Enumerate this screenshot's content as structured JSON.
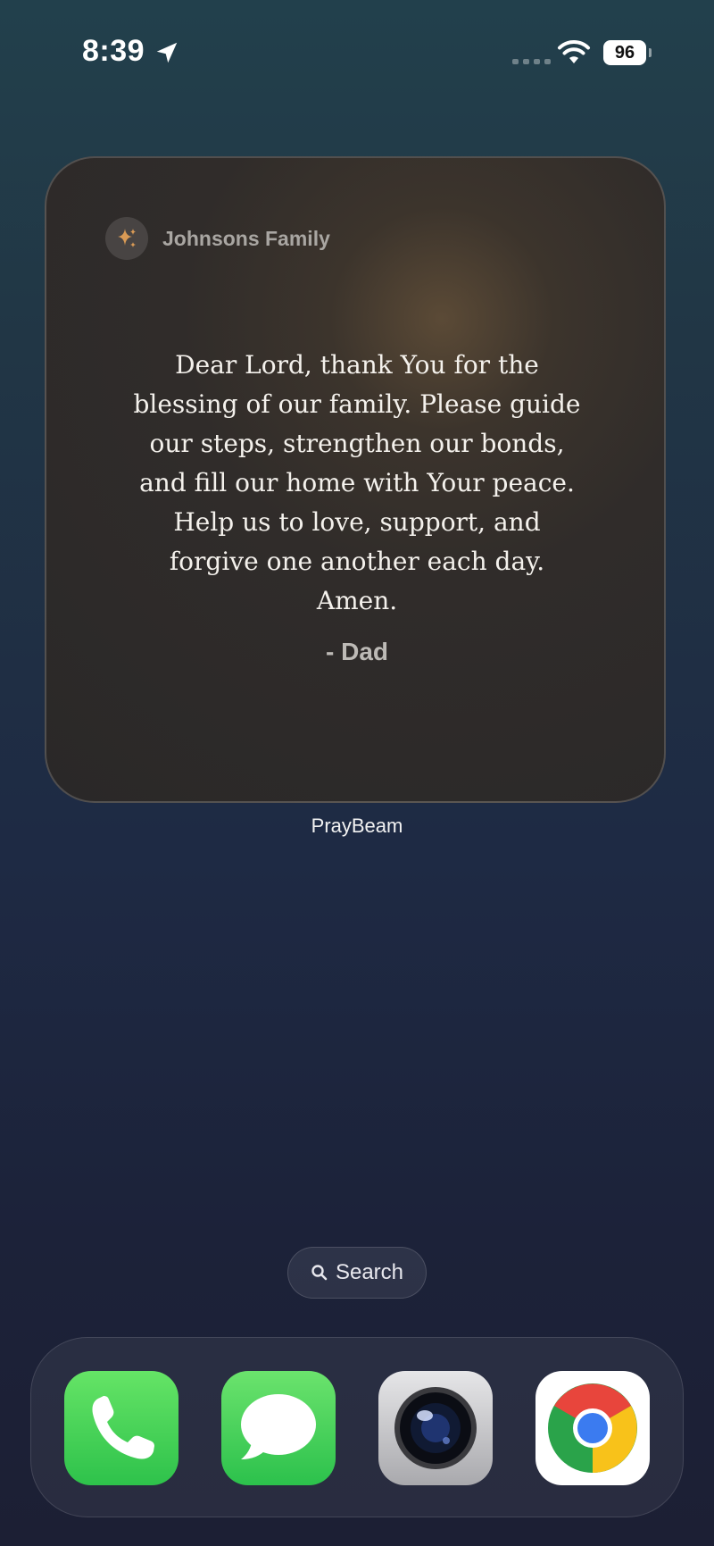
{
  "status_bar": {
    "time": "8:39",
    "battery": "96",
    "icons": [
      "location-arrow-icon",
      "cellular-signal-icon",
      "wifi-icon",
      "battery-icon"
    ]
  },
  "widget": {
    "group_name": "Johnsons Family",
    "icon": "sparkles-icon",
    "prayer_lines": [
      "Dear Lord, thank You for the",
      "blessing of our family. Please guide",
      "our steps, strengthen our bonds,",
      "and fill our home with Your peace.",
      "Help us to love, support, and",
      "forgive one another each day.",
      "Amen."
    ],
    "author": "- Dad",
    "app_label": "PrayBeam",
    "accent_color": "#d99a55"
  },
  "search": {
    "label": "Search",
    "icon": "search-icon"
  },
  "dock": {
    "apps": [
      {
        "name": "Phone",
        "icon": "phone-icon"
      },
      {
        "name": "Messages",
        "icon": "messages-icon"
      },
      {
        "name": "Camera",
        "icon": "camera-icon"
      },
      {
        "name": "Chrome",
        "icon": "chrome-icon"
      }
    ]
  }
}
